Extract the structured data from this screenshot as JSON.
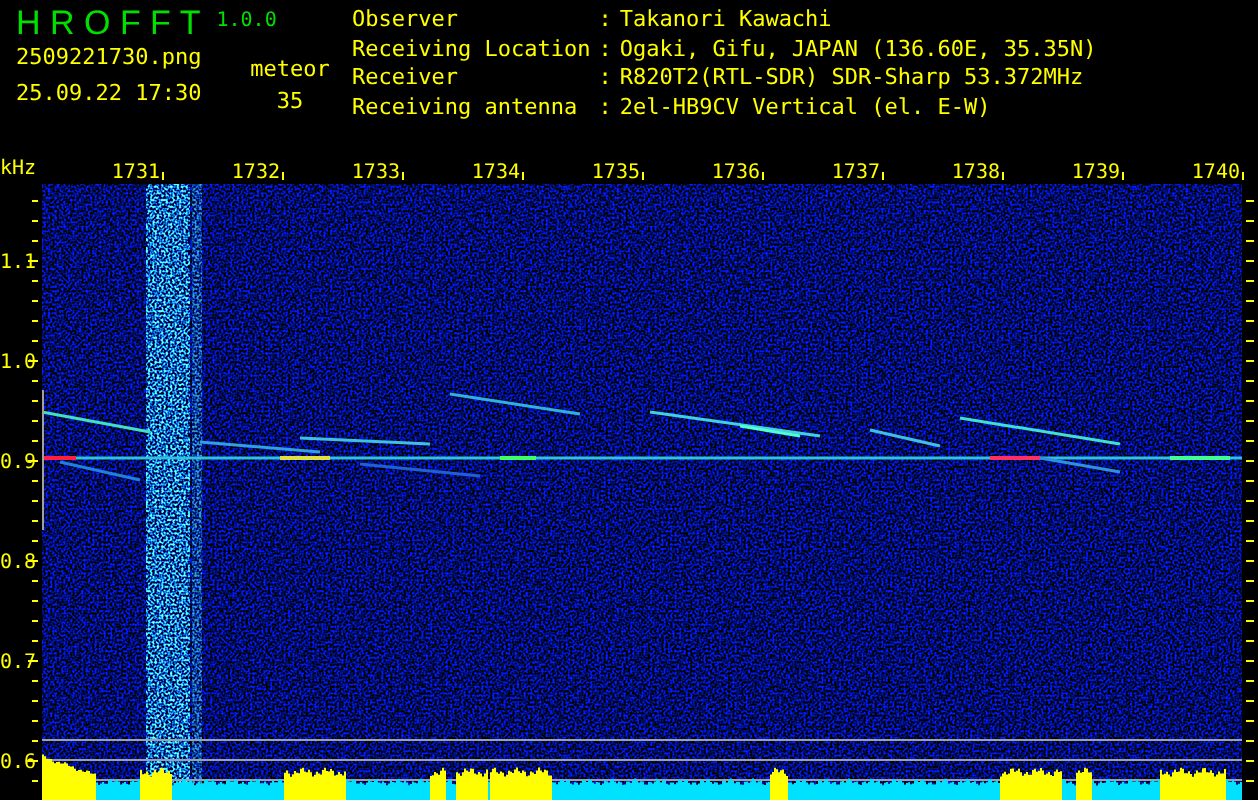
{
  "app": {
    "title": "H R O F F T",
    "version": "1.0.0"
  },
  "file": {
    "name": "2509221730.png",
    "datetime": "25.09.22 17:30"
  },
  "count": {
    "label": "meteor",
    "value": "35"
  },
  "info": [
    {
      "label": "Observer",
      "separator": ":",
      "value": "Takanori Kawachi"
    },
    {
      "label": "Receiving Location",
      "separator": ":",
      "value": "Ogaki, Gifu, JAPAN (136.60E, 35.35N)"
    },
    {
      "label": "Receiver",
      "separator": ":",
      "value": "R820T2(RTL-SDR) SDR-Sharp 53.372MHz"
    },
    {
      "label": "Receiving antenna",
      "separator": ":",
      "value": "2el-HB9CV Vertical (el. E-W)"
    }
  ],
  "plot": {
    "unit": "kHz",
    "x_ticks": [
      "1731",
      "1732",
      "1733",
      "1734",
      "1735",
      "1736",
      "1737",
      "1738",
      "1739",
      "1740"
    ],
    "y_ticks": [
      "1.1",
      "1.0",
      "0.9",
      "0.8",
      "0.7",
      "0.6"
    ]
  }
}
